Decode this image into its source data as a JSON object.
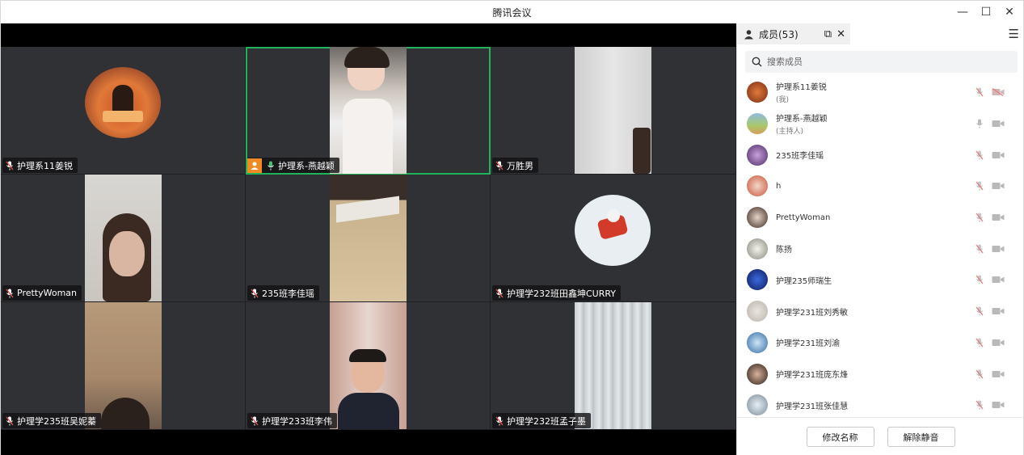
{
  "window": {
    "title": "腾讯会议",
    "minimize_glyph": "—",
    "maximize_glyph": "☐",
    "close_glyph": "✕"
  },
  "video_grid": {
    "tiles": [
      {
        "name": "护理系11姜锐",
        "muted": true,
        "host": false,
        "active": false
      },
      {
        "name": "护理系-燕越颖",
        "muted": false,
        "host": true,
        "active": true
      },
      {
        "name": "万胜男",
        "muted": true,
        "host": false,
        "active": false
      },
      {
        "name": "PrettyWoman",
        "muted": true,
        "host": false,
        "active": false
      },
      {
        "name": "235班李佳瑶",
        "muted": true,
        "host": false,
        "active": false
      },
      {
        "name": "护理学232班田鑫坤CURRY",
        "muted": true,
        "host": false,
        "active": false
      },
      {
        "name": "护理学235班吴妮蓁",
        "muted": true,
        "host": false,
        "active": false
      },
      {
        "name": "护理学233班李伟",
        "muted": true,
        "host": false,
        "active": false
      },
      {
        "name": "护理学232班孟子墨",
        "muted": true,
        "host": false,
        "active": false
      }
    ]
  },
  "panel": {
    "tab_label": "成员(53)",
    "popout_glyph": "⧉",
    "close_glyph": "✕",
    "menu_glyph": "☰",
    "search": {
      "placeholder": "搜索成员"
    },
    "members": [
      {
        "name": "护理系11姜锐",
        "role": "(我)",
        "mic_muted": true,
        "cam_off": true
      },
      {
        "name": "护理系-燕越颖",
        "role": "(主持人)",
        "mic_muted": false,
        "cam_off": false
      },
      {
        "name": "235班李佳瑶",
        "role": "",
        "mic_muted": true,
        "cam_off": false
      },
      {
        "name": "h",
        "role": "",
        "mic_muted": true,
        "cam_off": false
      },
      {
        "name": "PrettyWoman",
        "role": "",
        "mic_muted": true,
        "cam_off": false
      },
      {
        "name": "陈扬",
        "role": "",
        "mic_muted": true,
        "cam_off": false
      },
      {
        "name": "护理235师瑞生",
        "role": "",
        "mic_muted": true,
        "cam_off": false
      },
      {
        "name": "护理学231班刘秀敏",
        "role": "",
        "mic_muted": true,
        "cam_off": false
      },
      {
        "name": "护理学231班刘渝",
        "role": "",
        "mic_muted": true,
        "cam_off": false
      },
      {
        "name": "护理学231班庞东烽",
        "role": "",
        "mic_muted": true,
        "cam_off": false
      },
      {
        "name": "护理学231班张佳慧",
        "role": "",
        "mic_muted": true,
        "cam_off": false
      }
    ],
    "footer": {
      "rename_label": "修改名称",
      "unmute_all_label": "解除静音"
    }
  },
  "colors": {
    "active_speaker_border": "#1fb35a",
    "host_badge": "#f08a24",
    "muted_mic": "#e06060",
    "tile_bg": "#2f3135"
  }
}
